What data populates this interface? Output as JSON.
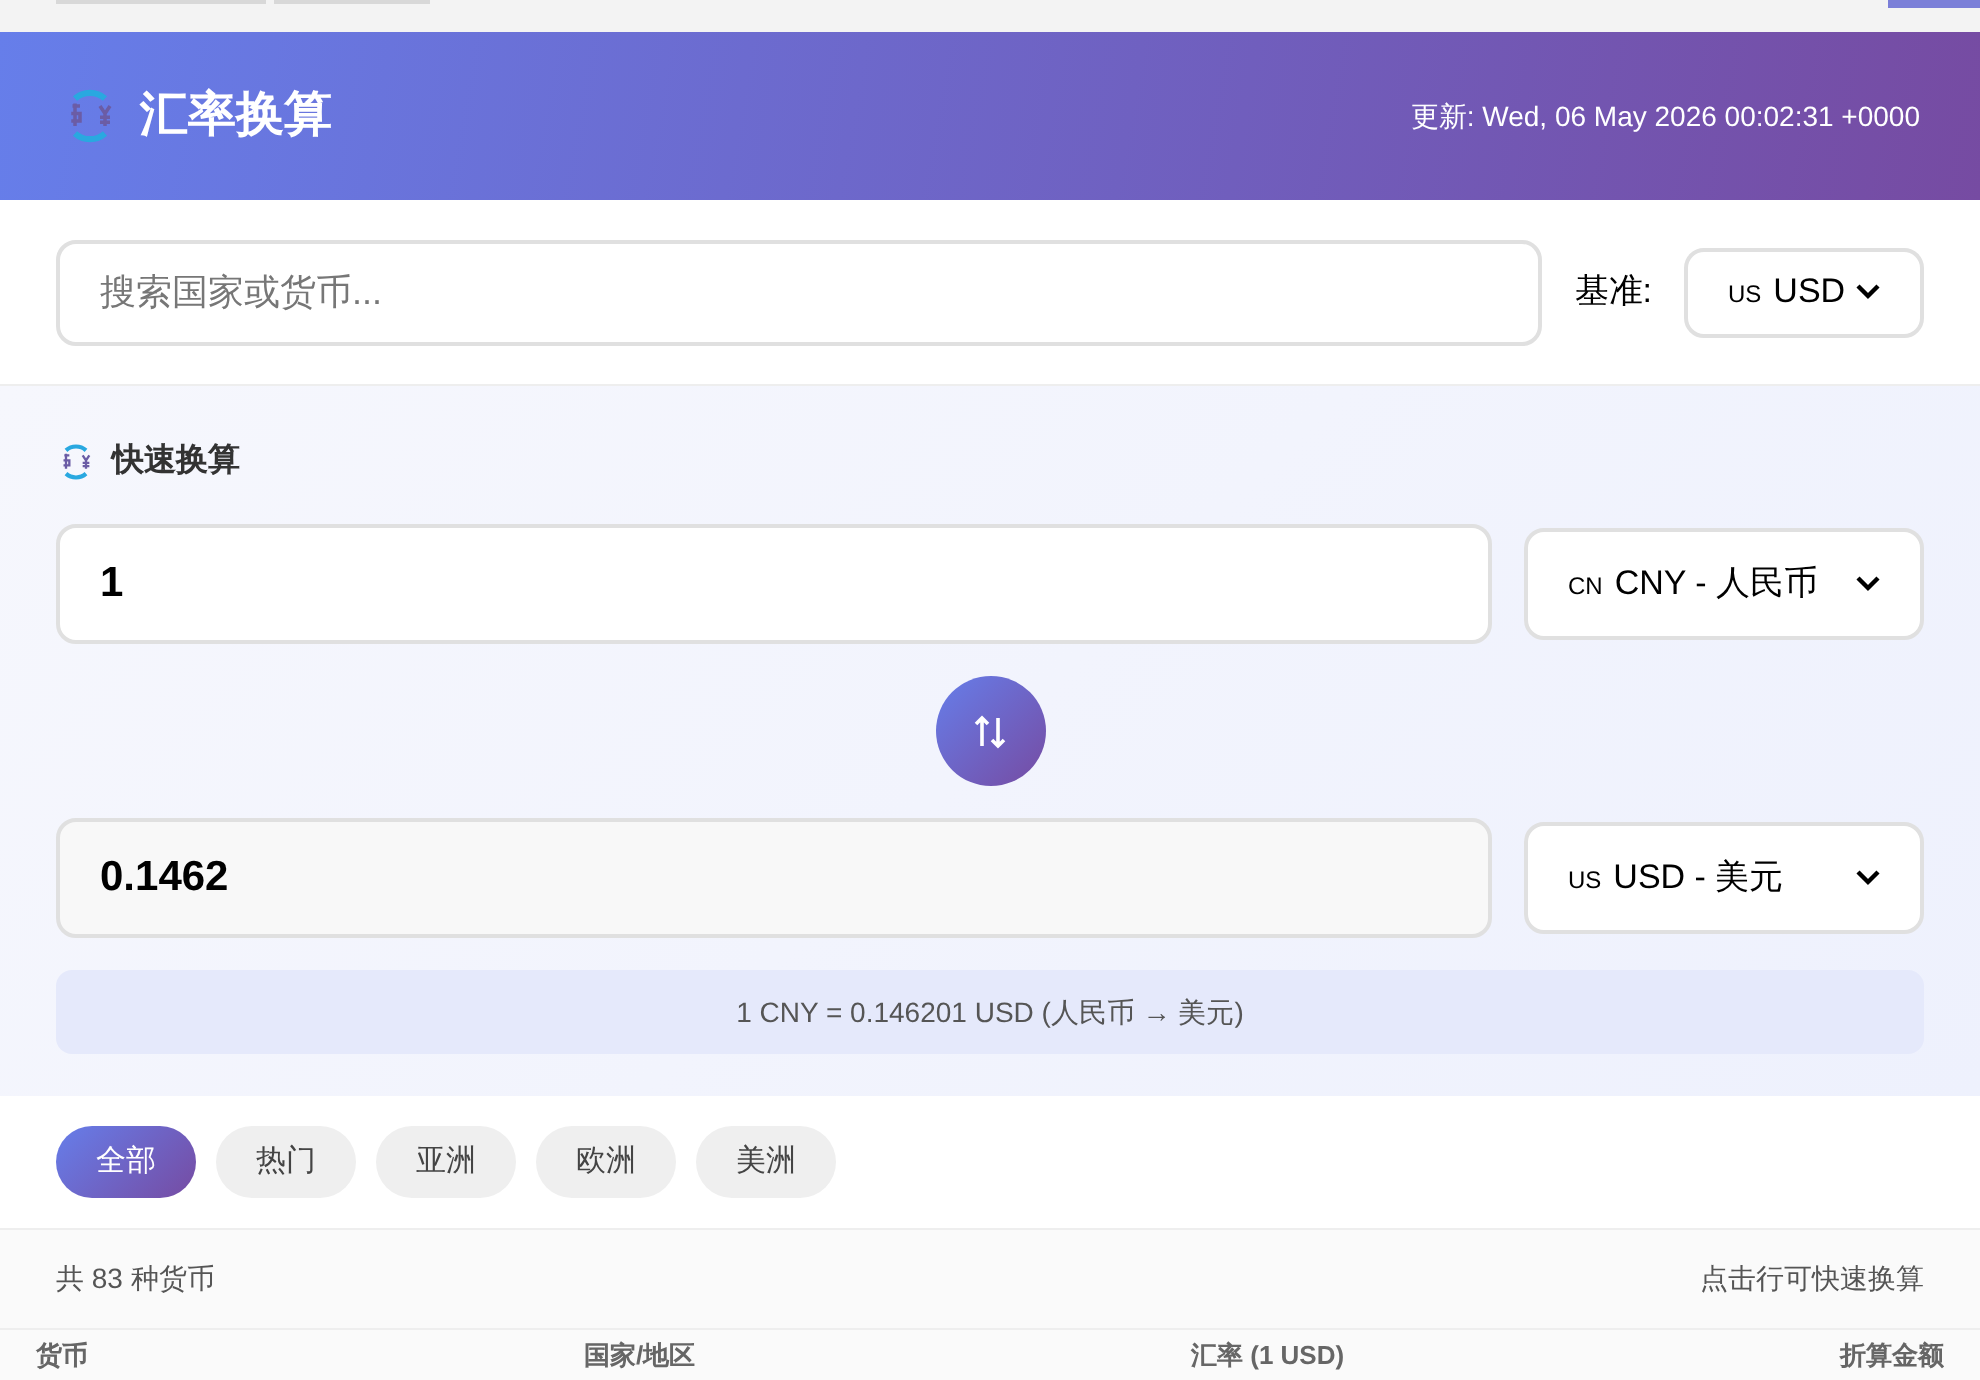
{
  "header": {
    "title": "汇率换算",
    "updated": "更新: Wed, 06 May 2026 00:02:31 +0000"
  },
  "search": {
    "placeholder": "搜索国家或货币...",
    "base_label": "基准:",
    "base_flag": "US",
    "base_value": "USD"
  },
  "converter": {
    "title": "快速换算",
    "amount": "1",
    "from_flag": "CN",
    "from_value": "CNY - 人民币",
    "result": "0.1462",
    "to_flag": "US",
    "to_value": "USD - 美元",
    "rate_text": "1 CNY = 0.146201 USD (人民币 → 美元)"
  },
  "filters": [
    {
      "label": "全部",
      "selected": true
    },
    {
      "label": "热门",
      "selected": false
    },
    {
      "label": "亚洲",
      "selected": false
    },
    {
      "label": "欧洲",
      "selected": false
    },
    {
      "label": "美洲",
      "selected": false
    }
  ],
  "summary": {
    "count": "共 83 种货币",
    "hint": "点击行可快速换算"
  },
  "table": {
    "columns": [
      "货币",
      "国家/地区",
      "汇率 (1 USD)",
      "折算金额"
    ]
  }
}
